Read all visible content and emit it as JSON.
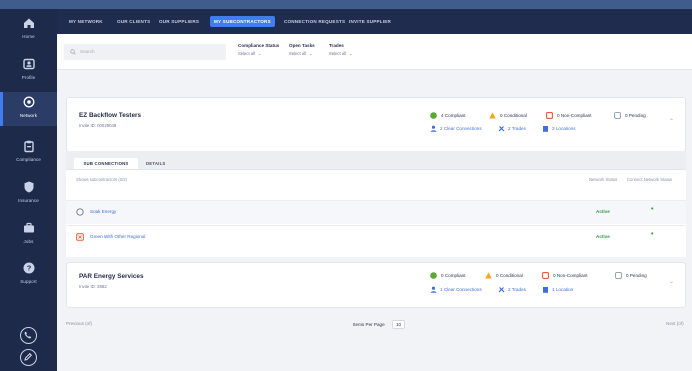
{
  "nav": {
    "items": [
      {
        "label": "Home",
        "icon": "home-icon"
      },
      {
        "label": "Profile",
        "icon": "profile-icon"
      },
      {
        "label": "Network",
        "icon": "network-icon",
        "active": true
      },
      {
        "label": "Compliance",
        "icon": "clipboard-icon"
      },
      {
        "label": "Insurance",
        "icon": "shield-icon"
      },
      {
        "label": "Jobs",
        "icon": "briefcase-icon"
      },
      {
        "label": "Support",
        "icon": "help-icon"
      }
    ]
  },
  "tabs": [
    {
      "label": "MY NETWORK"
    },
    {
      "label": "OUR CLIENTS"
    },
    {
      "label": "OUR SUPPLIERS"
    },
    {
      "label": "MY SUBCONTRACTORS",
      "active": true
    },
    {
      "label": "CONNECTION REQUESTS"
    },
    {
      "label": "INVITE SUPPLIER"
    }
  ],
  "filters": {
    "search_placeholder": "Search",
    "compliance_status": {
      "label": "Compliance Status",
      "value": "Select all"
    },
    "open_tasks": {
      "label": "Open Tasks",
      "value": "Select all"
    },
    "trades": {
      "label": "Trades",
      "value": "Select all"
    }
  },
  "cards": [
    {
      "title": "EZ Backflow Testers",
      "subtitle": "Invite ID: 00029048",
      "stats": {
        "compliant": "4 Compliant",
        "conditional": "0 Conditional",
        "non_compliant": "0 Non-Compliant",
        "pending": "0 Pending"
      },
      "links": {
        "connections": "2 Clear Connections",
        "trades": "2 Trades",
        "locations": "3 Locations"
      }
    },
    {
      "title": "PAR Energy Services",
      "subtitle": "Invite ID: 2882",
      "stats": {
        "compliant": "0 Compliant",
        "conditional": "0 Conditional",
        "non_compliant": "0 Non-Compliant",
        "pending": "0 Pending"
      },
      "links": {
        "connections": "1 Clear Connections",
        "trades": "2 Trades",
        "locations": "1 Location"
      }
    }
  ],
  "subpanel": {
    "tab_active": "SUB CONNECTIONS",
    "tab_other": "DETAILS",
    "header_left": "Shows subcontractors (0/2)",
    "header_mid": "Network Status",
    "header_right": "Connect Network Status",
    "rows": [
      {
        "name": "Soak Energy",
        "status": "Active",
        "more": "•"
      },
      {
        "name": "Green With Other Regional",
        "status": "Active",
        "more": "•"
      }
    ]
  },
  "footer": {
    "left": "Previous (of)",
    "items_per_page_label": "Items Per Page",
    "items_per_page_value": "10",
    "right": "Next (of)"
  },
  "colors": {
    "sidebar": "#1d2a4a",
    "tabbar": "#1f2c4e",
    "accent": "#3f7ef0",
    "compliant": "#5aa832",
    "conditional": "#f2a81e",
    "non_compliant": "#e45c3a",
    "link": "#3f6ed8",
    "active_status": "#2f9a4a"
  }
}
